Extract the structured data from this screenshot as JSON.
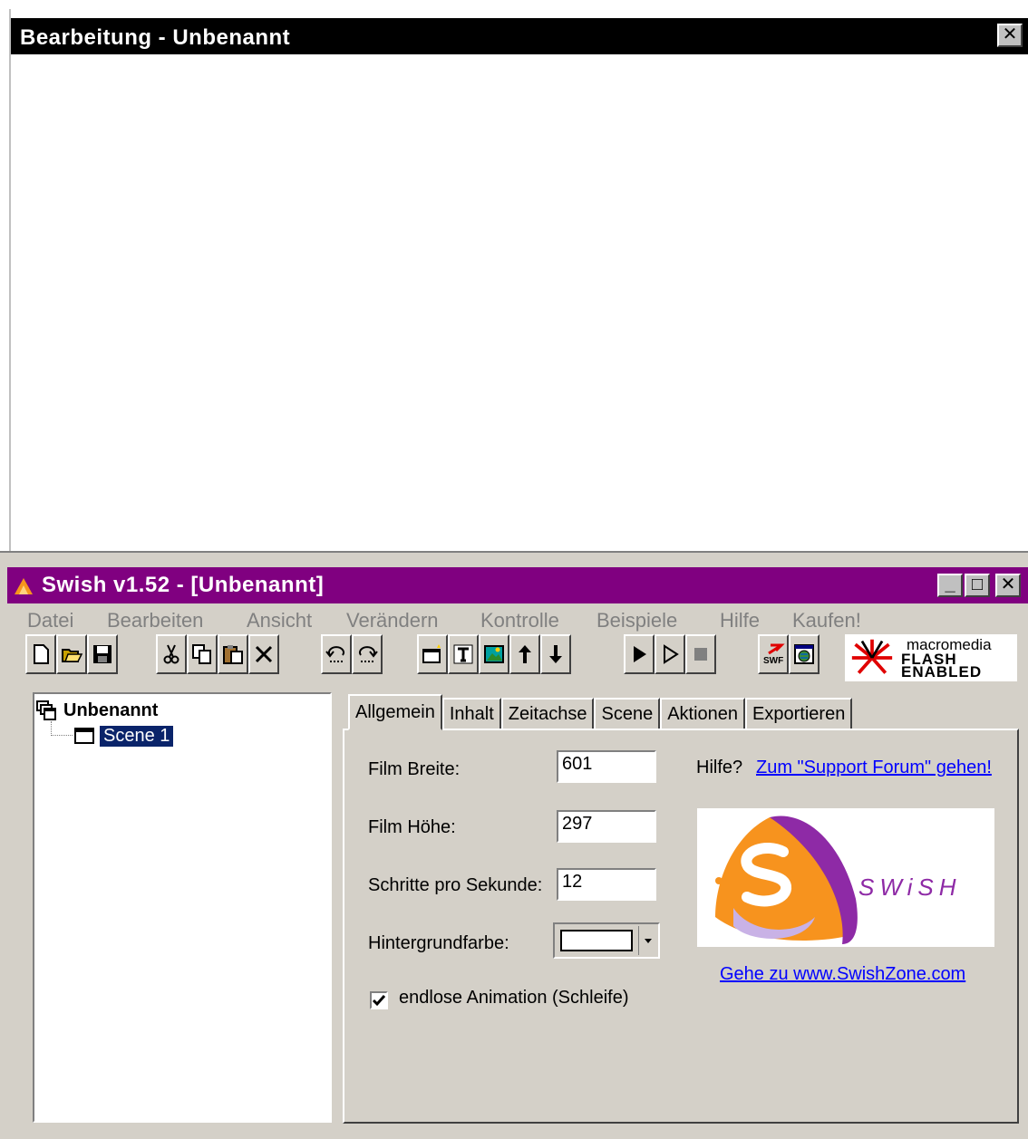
{
  "edit_window": {
    "title": "Bearbeitung - Unbenannt",
    "close_glyph": "✕"
  },
  "main_window": {
    "title": "Swish v1.52 - [Unbenannt]",
    "controls": {
      "min": "_",
      "max": "□",
      "close": "✕"
    }
  },
  "menu": [
    "Datei",
    "Bearbeiten",
    "Ansicht",
    "Verändern",
    "Kontrolle",
    "Beispiele",
    "Hilfe",
    "Kaufen!"
  ],
  "toolbar": {
    "groups": [
      [
        "new-icon",
        "open-icon",
        "save-icon"
      ],
      [
        "cut-icon",
        "copy-icon",
        "paste-icon",
        "delete-icon"
      ],
      [
        "undo-icon",
        "redo-icon"
      ],
      [
        "insert-scene-icon",
        "insert-text-icon",
        "insert-image-icon",
        "move-up-icon",
        "move-down-icon"
      ],
      [
        "play-icon",
        "play-step-icon",
        "stop-icon"
      ],
      [
        "export-swf-icon",
        "preview-browser-icon"
      ]
    ]
  },
  "flash_logo": {
    "line1": "macromedia",
    "line2": "FLASH",
    "line3": "ENABLED"
  },
  "tree": {
    "root": "Unbenannt",
    "scene": "Scene 1"
  },
  "tabs": [
    "Allgemein",
    "Inhalt",
    "Zeitachse",
    "Scene",
    "Aktionen",
    "Exportieren"
  ],
  "active_tab": "Allgemein",
  "settings": {
    "width_label": "Film Breite:",
    "width_value": "601",
    "height_label": "Film Höhe:",
    "height_value": "297",
    "fps_label": "Schritte pro Sekunde:",
    "fps_value": "12",
    "bg_label": "Hintergrundfarbe:",
    "bg_color": "#ffffff",
    "loop_label": "endlose Animation (Schleife)",
    "loop_checked": true
  },
  "help": {
    "prefix": "Hilfe?",
    "link": "Zum \"Support Forum\" gehen!"
  },
  "swish_logo": {
    "word": "SWiSH"
  },
  "swishzone_link": "Gehe zu  www.SwishZone.com",
  "colors": {
    "titlebar_main": "#800080",
    "titlebar_edit": "#000000",
    "selection": "#0a246a",
    "face": "#d4d0c8",
    "link": "#0000ff"
  }
}
